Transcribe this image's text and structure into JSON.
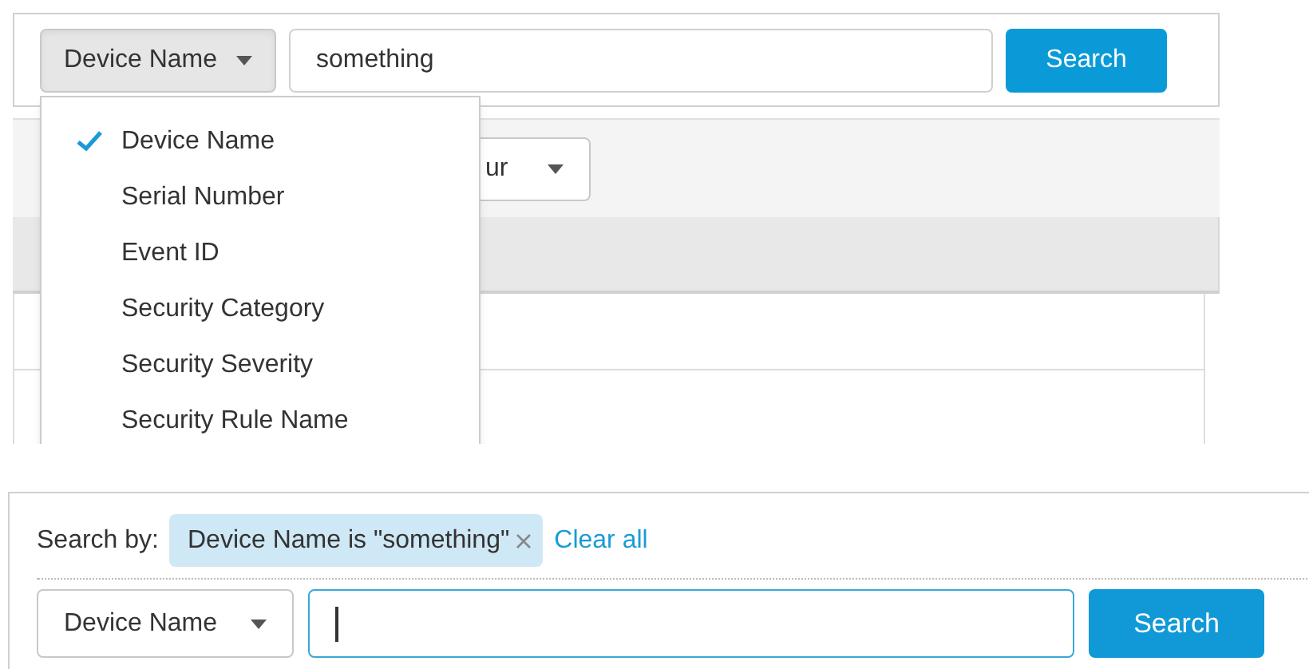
{
  "top_search": {
    "field_select": {
      "value": "Device Name",
      "expanded": true
    },
    "query": {
      "value": "something",
      "focused": false
    },
    "button": "Search"
  },
  "toolbar": {
    "time_select": {
      "value": "ur"
    }
  },
  "field_menu": {
    "items": [
      {
        "label": "Device Name",
        "selected": true
      },
      {
        "label": "Serial Number",
        "selected": false
      },
      {
        "label": "Event ID",
        "selected": false
      },
      {
        "label": "Security Category",
        "selected": false
      },
      {
        "label": "Security Severity",
        "selected": false
      },
      {
        "label": "Security Rule Name",
        "selected": false
      }
    ]
  },
  "bottom_search": {
    "label": "Search by:",
    "chips": [
      {
        "text": "Device Name is \"something\""
      }
    ],
    "clear_all": "Clear all",
    "field_select": {
      "value": "Device Name",
      "expanded": false
    },
    "query": {
      "focused": true
    },
    "button": "Search"
  }
}
